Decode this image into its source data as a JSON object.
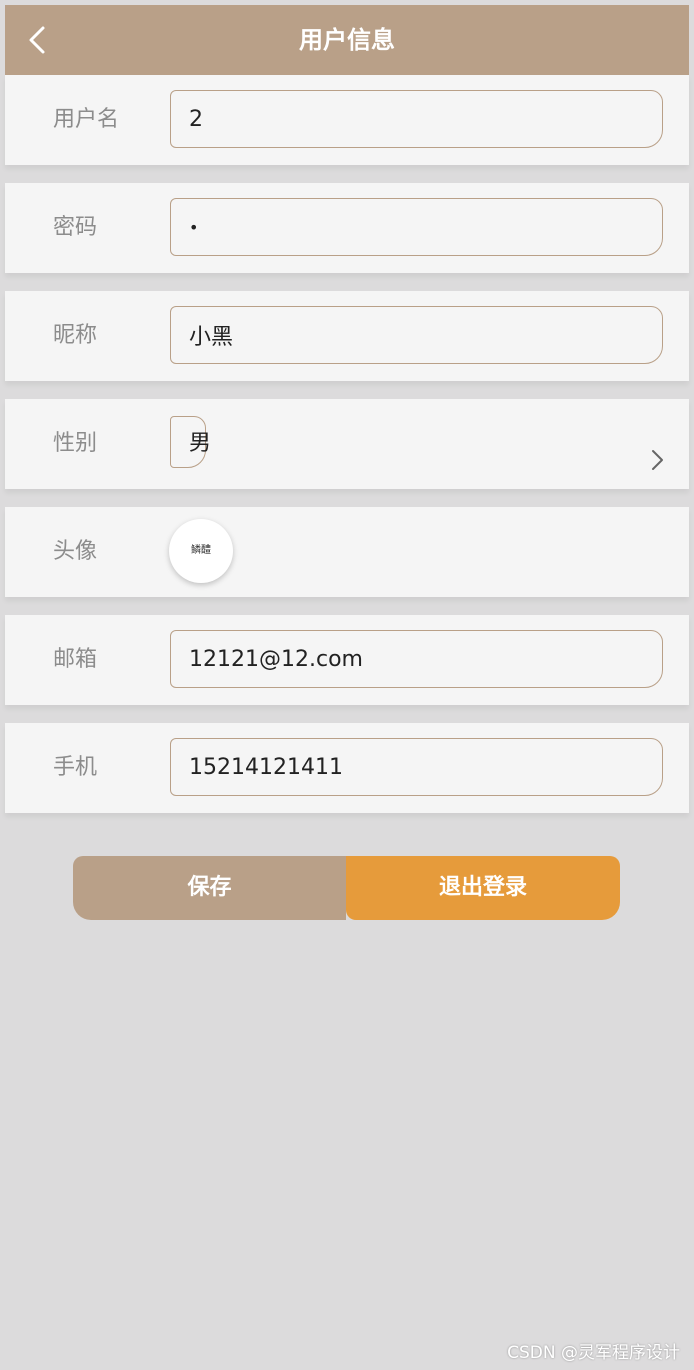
{
  "header": {
    "title": "用户信息",
    "back_icon": "chevron-left-icon"
  },
  "form": {
    "username": {
      "label": "用户名",
      "value": "2"
    },
    "password": {
      "label": "密码",
      "value": "•"
    },
    "nickname": {
      "label": "昵称",
      "value": "小黑"
    },
    "gender": {
      "label": "性别",
      "value": "男",
      "icon": "chevron-right-icon"
    },
    "avatar": {
      "label": "头像",
      "image_text": "鳞醴"
    },
    "email": {
      "label": "邮箱",
      "value": "12121@12.com"
    },
    "phone": {
      "label": "手机",
      "value": "15214121411"
    }
  },
  "actions": {
    "save_label": "保存",
    "logout_label": "退出登录"
  },
  "watermark": "CSDN @灵军程序设计",
  "colors": {
    "header_bg": "#b9a088",
    "save_bg": "#b9a088",
    "logout_bg": "#e69b3b",
    "page_bg": "#dcdbdc",
    "row_bg": "#f5f5f5"
  }
}
